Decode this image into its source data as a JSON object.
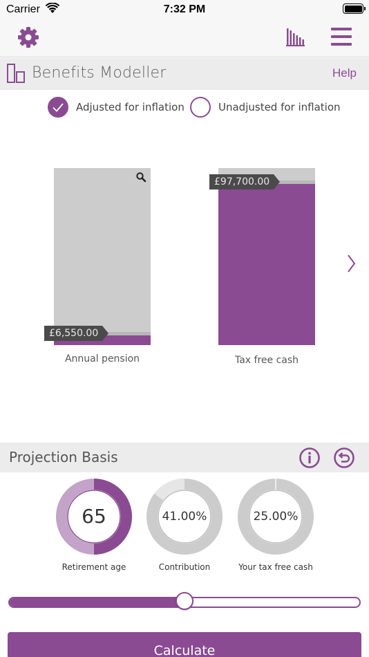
{
  "status_bar": {
    "carrier": "Carrier",
    "time": "7:32 PM"
  },
  "nav": {
    "icons": [
      "gear-icon",
      "bar-chart-icon",
      "hamburger-menu-icon"
    ]
  },
  "header": {
    "title": "Benefits Modeller",
    "help": "Help"
  },
  "inflation_toggle": {
    "options": [
      {
        "label": "Adjusted for inflation",
        "selected": true
      },
      {
        "label": "Unadjusted for inflation",
        "selected": false
      }
    ]
  },
  "bars": [
    {
      "caption": "Annual pension",
      "value": "£6,550.00",
      "fill_fraction": 0.055
    },
    {
      "caption": "Tax free cash",
      "value": "£97,700.00",
      "fill_fraction": 0.91
    }
  ],
  "projection": {
    "title": "Projection Basis",
    "dials": [
      {
        "value": "65",
        "caption": "Retirement age"
      },
      {
        "value": "41.00%",
        "caption": "Contribution"
      },
      {
        "value": "25.00%",
        "caption": "Your tax free cash"
      }
    ]
  },
  "slider": {
    "fraction": 0.5
  },
  "calculate_label": "Calculate",
  "colors": {
    "accent": "#8a4b93",
    "bar_bg": "#cccccc",
    "tag_bg": "#4a4a4a"
  }
}
